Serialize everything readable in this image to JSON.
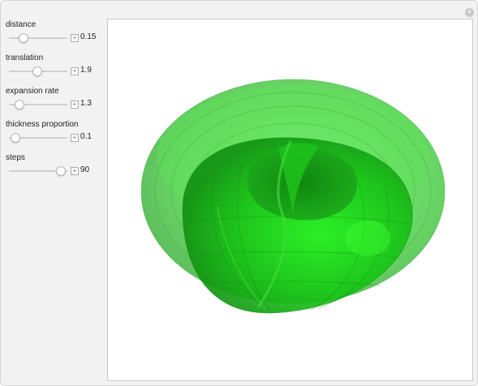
{
  "controls": [
    {
      "label": "distance",
      "value": "0.15",
      "fraction": 0.19
    },
    {
      "label": "translation",
      "value": "1.9",
      "fraction": 0.47
    },
    {
      "label": "expansion rate",
      "value": "1.3",
      "fraction": 0.11
    },
    {
      "label": "thickness proportion",
      "value": "0.1",
      "fraction": 0.04
    },
    {
      "label": "steps",
      "value": "90",
      "fraction": 0.93
    }
  ],
  "icons": {
    "reset": "plus-circle-icon",
    "expand": "plus-square-icon"
  },
  "colors": {
    "surface_green": "#22c51f",
    "surface_bright": "#44ee3a",
    "surface_dark": "#138f12",
    "panel_background": "#f2f2f2"
  }
}
